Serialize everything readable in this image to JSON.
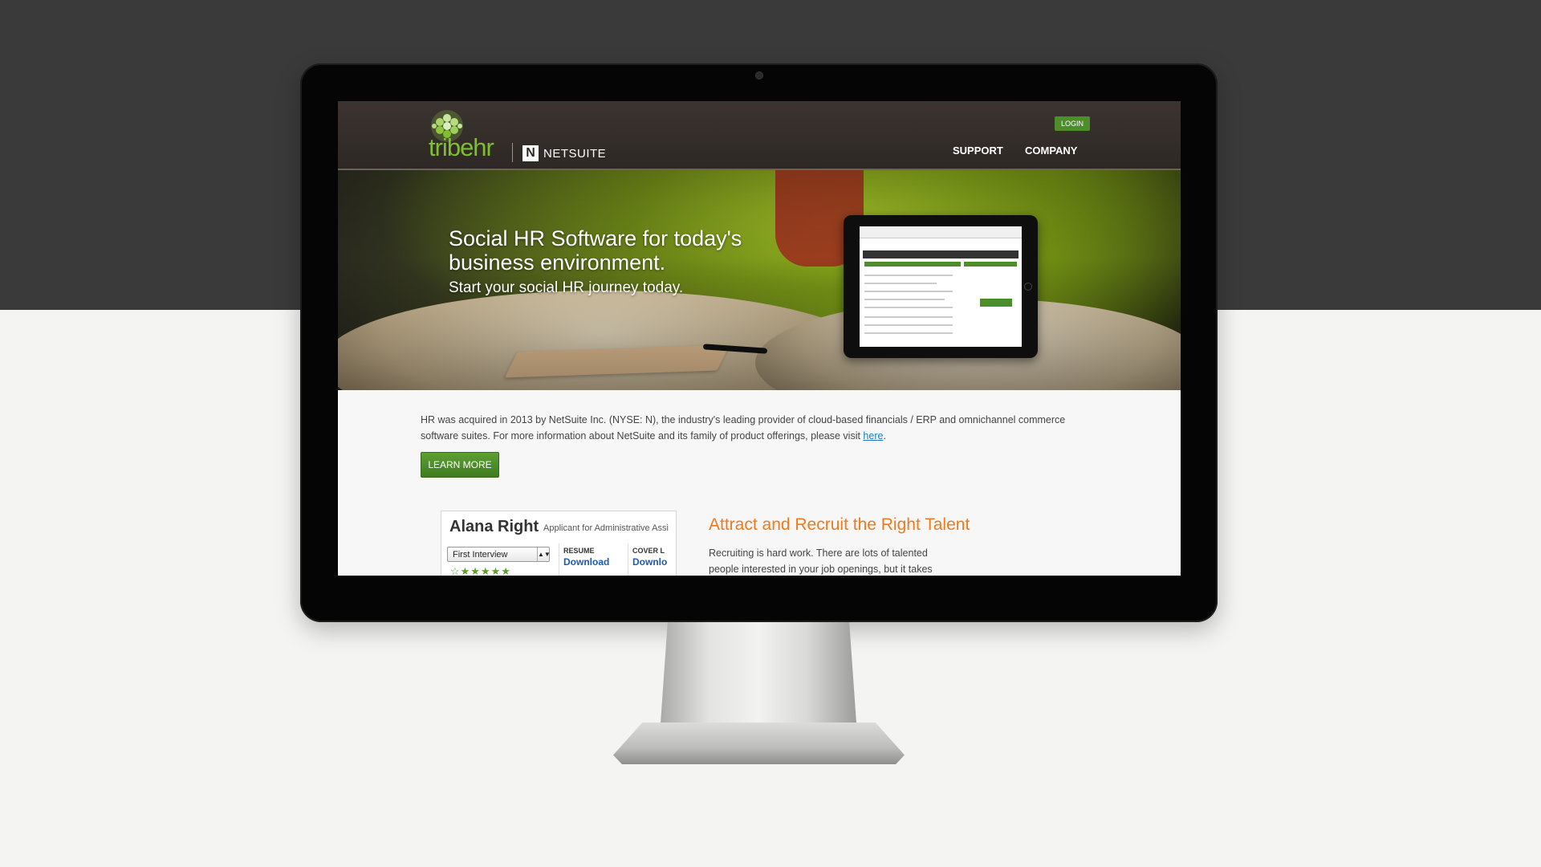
{
  "brand": {
    "logo_text": "tribehr",
    "partner_mark": "N",
    "partner_name": "NETSUITE"
  },
  "header": {
    "login_label": "LOGIN",
    "nav": [
      "SUPPORT",
      "COMPANY"
    ]
  },
  "hero": {
    "title": "Social HR Software for today's business environment.",
    "subtitle": "Start your social HR journey today."
  },
  "about": {
    "text_before_link": "HR was acquired in 2013 by NetSuite Inc. (NYSE: N), the industry's leading provider of cloud-based financials / ERP and omnichannel commerce software suites. For more information about NetSuite and its family of product offerings, please visit ",
    "link_text": "here",
    "text_after_link": ".",
    "button_label": "LEARN MORE"
  },
  "candidate_card": {
    "name": "Alana Right",
    "role": "Applicant for Administrative Assi",
    "stage": "First Interview",
    "resume_label": "RESUME",
    "resume_action": "Download",
    "cover_label": "COVER L",
    "cover_action": "Downlo",
    "stars": "☆★★★★★"
  },
  "feature": {
    "title": "Attract and Recruit the Right Talent",
    "text": "Recruiting is hard work. There are lots of talented people interested in your job openings, but it takes"
  },
  "colors": {
    "brand_green": "#7fbf2e",
    "button_green": "#4e8d2b",
    "accent_orange": "#f07a1c",
    "link_blue": "#1a7fc1",
    "header_bg": "#2e2825"
  }
}
